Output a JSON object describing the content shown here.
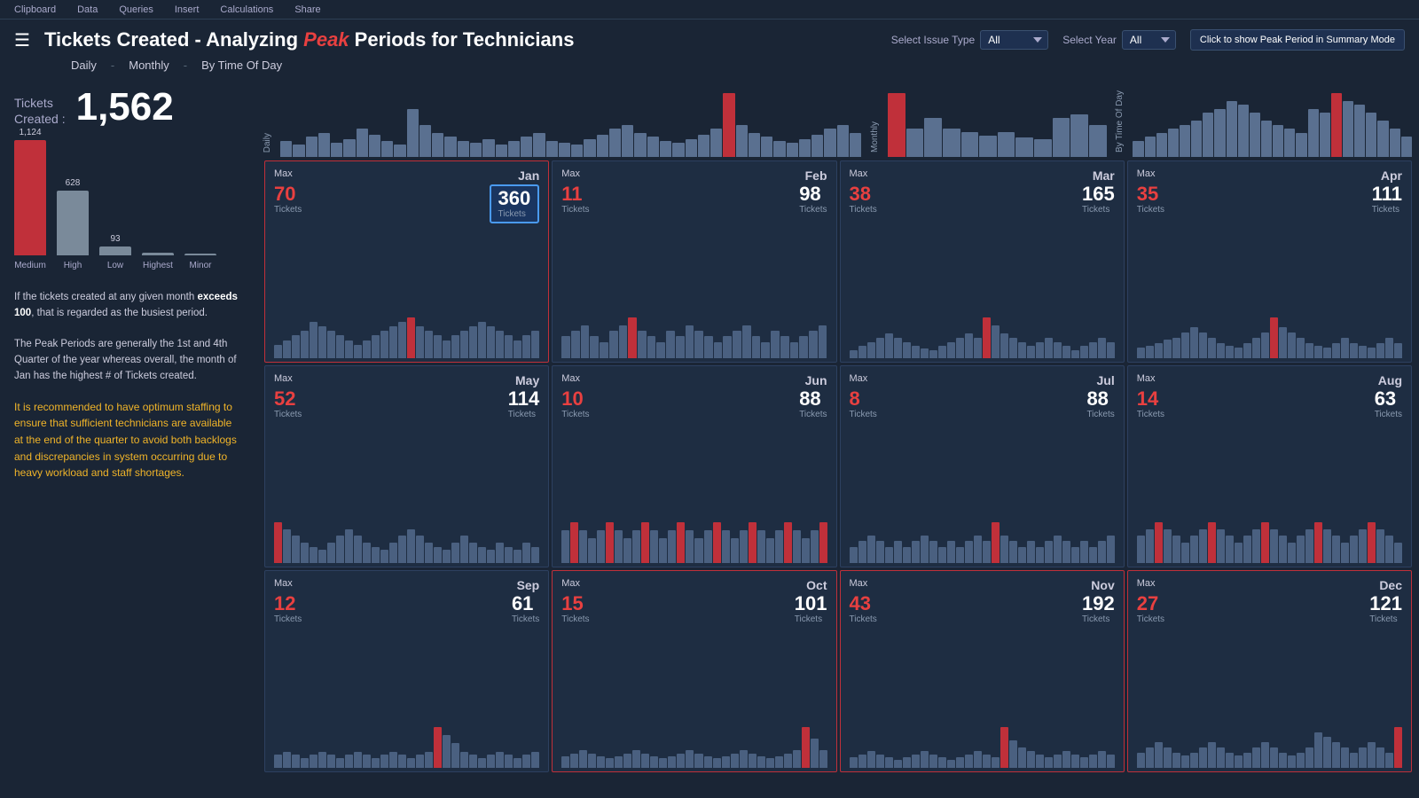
{
  "topbar": {
    "items": [
      "Clipboard",
      "Data",
      "Queries",
      "Insert",
      "Calculations",
      "Share"
    ]
  },
  "header": {
    "title_prefix": "Tickets Created",
    "title_dash": " - ",
    "title_analyzing": "Analyzing ",
    "title_peak": "Peak",
    "title_suffix": " Periods for Technicians"
  },
  "nav": {
    "daily": "Daily",
    "sep1": "-",
    "monthly": "Monthly",
    "sep2": "-",
    "byTimeOfDay": "By Time Of Day"
  },
  "controls": {
    "issueTypeLabel": "Select Issue Type",
    "issueTypeValue": "All",
    "yearLabel": "Select Year",
    "yearValue": "All",
    "peakModeBtn": "Click to show Peak Period in Summary Mode"
  },
  "leftPanel": {
    "ticketsCreatedLabel": "Tickets\nCreated :",
    "ticketsCount": "1,562",
    "bars": [
      {
        "label": "Medium",
        "value": 1124,
        "displayVal": "1,124",
        "color": "#c0303a",
        "heightPct": 100
      },
      {
        "label": "High",
        "value": 628,
        "displayVal": "628",
        "color": "#7a8a9a",
        "heightPct": 56
      },
      {
        "label": "Low",
        "value": 93,
        "displayVal": "93",
        "color": "#7a8a9a",
        "heightPct": 8
      },
      {
        "label": "Highest",
        "value": 0,
        "displayVal": "",
        "color": "#7a8a9a",
        "heightPct": 2
      },
      {
        "label": "Minor",
        "value": 0,
        "displayVal": "",
        "color": "#7a8a9a",
        "heightPct": 1
      }
    ],
    "infoText1": "If the tickets created at any given month ",
    "infoTextBold": "exceeds 100",
    "infoText2": ", that is regarded as the busiest period.",
    "infoText3": "The Peak Periods are generally the 1st and 4th Quarter of the year whereas overall, the month of Jan has the highest # of Tickets created.",
    "recommendation": "It is recommended to have optimum staffing to ensure that sufficient technicians are available at the end of the quarter to avoid both backlogs and discrepancies in system occurring due to heavy workload and staff shortages."
  },
  "overviewCharts": {
    "daily": {
      "label": "Daily",
      "bars": [
        20,
        15,
        25,
        30,
        18,
        22,
        35,
        28,
        20,
        15,
        60,
        40,
        30,
        25,
        20,
        18,
        22,
        15,
        20,
        25,
        30,
        20,
        18,
        15,
        22,
        28,
        35,
        40,
        30,
        25,
        20,
        18,
        22,
        28,
        35,
        80,
        40,
        30,
        25,
        20,
        18,
        22,
        28,
        35,
        40,
        30
      ]
    },
    "monthly": {
      "label": "Monthly",
      "bars": [
        90,
        40,
        55,
        40,
        35,
        30,
        35,
        28,
        25,
        55,
        60,
        45
      ]
    },
    "byTimeOfDay": {
      "label": "By Time Of Day",
      "bars": [
        20,
        25,
        30,
        35,
        40,
        45,
        55,
        60,
        70,
        65,
        55,
        45,
        40,
        35,
        30,
        60,
        55,
        80,
        70,
        65,
        55,
        45,
        35,
        25
      ]
    }
  },
  "months": [
    {
      "name": "Jan",
      "maxVal": 70,
      "maxLabel": "Max",
      "totalVal": 360,
      "totalLabel": "Tickets",
      "peak": true,
      "highlighted": false,
      "bars": [
        15,
        20,
        25,
        30,
        40,
        35,
        30,
        25,
        20,
        15,
        20,
        25,
        30,
        35,
        40,
        45,
        35,
        30,
        25,
        20,
        25,
        30,
        35,
        40,
        35,
        30,
        25,
        20,
        25,
        30
      ]
    },
    {
      "name": "Feb",
      "maxVal": 11,
      "maxLabel": "Max",
      "totalVal": 98,
      "totalLabel": "Tickets",
      "peak": false,
      "bars": [
        8,
        10,
        12,
        8,
        6,
        10,
        12,
        15,
        10,
        8,
        6,
        10,
        8,
        12,
        10,
        8,
        6,
        8,
        10,
        12,
        8,
        6,
        10,
        8,
        6,
        8,
        10,
        12
      ]
    },
    {
      "name": "Mar",
      "maxVal": 38,
      "maxLabel": "Max",
      "totalVal": 165,
      "totalLabel": "Tickets",
      "peak": false,
      "bars": [
        10,
        15,
        20,
        25,
        30,
        25,
        20,
        15,
        12,
        10,
        15,
        20,
        25,
        30,
        25,
        50,
        40,
        30,
        25,
        20,
        15,
        20,
        25,
        20,
        15,
        10,
        15,
        20,
        25,
        20
      ]
    },
    {
      "name": "Apr",
      "maxVal": 35,
      "maxLabel": "Max",
      "totalVal": 111,
      "totalLabel": "Tickets",
      "peak": false,
      "bars": [
        10,
        12,
        15,
        18,
        20,
        25,
        30,
        25,
        20,
        15,
        12,
        10,
        15,
        20,
        25,
        40,
        30,
        25,
        20,
        15,
        12,
        10,
        15,
        20,
        15,
        12,
        10,
        15,
        20,
        15
      ]
    },
    {
      "name": "May",
      "maxVal": 52,
      "maxLabel": "Max",
      "totalVal": 114,
      "totalLabel": "Tickets",
      "peak": false,
      "bars": [
        30,
        25,
        20,
        15,
        12,
        10,
        15,
        20,
        25,
        20,
        15,
        12,
        10,
        15,
        20,
        25,
        20,
        15,
        12,
        10,
        15,
        20,
        15,
        12,
        10,
        15,
        12,
        10,
        15,
        12
      ]
    },
    {
      "name": "Jun",
      "maxVal": 10,
      "maxLabel": "Max",
      "totalVal": 88,
      "totalLabel": "Tickets",
      "peak": false,
      "bars": [
        8,
        10,
        8,
        6,
        8,
        10,
        8,
        6,
        8,
        10,
        8,
        6,
        8,
        10,
        8,
        6,
        8,
        10,
        8,
        6,
        8,
        10,
        8,
        6,
        8,
        10,
        8,
        6,
        8,
        10
      ]
    },
    {
      "name": "Jul",
      "maxVal": 8,
      "maxLabel": "Max",
      "totalVal": 88,
      "totalLabel": "Tickets",
      "peak": false,
      "bars": [
        6,
        8,
        10,
        8,
        6,
        8,
        6,
        8,
        10,
        8,
        6,
        8,
        6,
        8,
        10,
        8,
        15,
        10,
        8,
        6,
        8,
        6,
        8,
        10,
        8,
        6,
        8,
        6,
        8,
        10
      ]
    },
    {
      "name": "Aug",
      "maxVal": 14,
      "maxLabel": "Max",
      "totalVal": 63,
      "totalLabel": "Tickets",
      "peak": false,
      "bars": [
        8,
        10,
        12,
        10,
        8,
        6,
        8,
        10,
        12,
        10,
        8,
        6,
        8,
        10,
        12,
        10,
        8,
        6,
        8,
        10,
        12,
        10,
        8,
        6,
        8,
        10,
        12,
        10,
        8,
        6
      ]
    },
    {
      "name": "Sep",
      "maxVal": 12,
      "maxLabel": "Max",
      "totalVal": 61,
      "totalLabel": "Tickets",
      "peak": false,
      "bars": [
        8,
        10,
        8,
        6,
        8,
        10,
        8,
        6,
        8,
        10,
        8,
        6,
        8,
        10,
        8,
        6,
        8,
        10,
        25,
        20,
        15,
        10,
        8,
        6,
        8,
        10,
        8,
        6,
        8,
        10
      ]
    },
    {
      "name": "Oct",
      "maxVal": 15,
      "maxLabel": "Max",
      "totalVal": 101,
      "totalLabel": "Tickets",
      "peak": true,
      "bars": [
        10,
        12,
        15,
        12,
        10,
        8,
        10,
        12,
        15,
        12,
        10,
        8,
        10,
        12,
        15,
        12,
        10,
        8,
        10,
        12,
        15,
        12,
        10,
        8,
        10,
        12,
        15,
        35,
        25,
        15
      ]
    },
    {
      "name": "Nov",
      "maxVal": 43,
      "maxLabel": "Max",
      "totalVal": 192,
      "totalLabel": "Tickets",
      "peak": true,
      "bars": [
        15,
        20,
        25,
        20,
        15,
        12,
        15,
        20,
        25,
        20,
        15,
        12,
        15,
        20,
        25,
        20,
        15,
        60,
        40,
        30,
        25,
        20,
        15,
        20,
        25,
        20,
        15,
        20,
        25,
        20
      ]
    },
    {
      "name": "Dec",
      "maxVal": 27,
      "maxLabel": "Max",
      "totalVal": 121,
      "totalLabel": "Tickets",
      "peak": true,
      "bars": [
        15,
        20,
        25,
        20,
        15,
        12,
        15,
        20,
        25,
        20,
        15,
        12,
        15,
        20,
        25,
        20,
        15,
        12,
        15,
        20,
        35,
        30,
        25,
        20,
        15,
        20,
        25,
        20,
        15,
        40
      ]
    }
  ],
  "janHighlight": {
    "maxVal": 70,
    "totalVal": 360
  }
}
